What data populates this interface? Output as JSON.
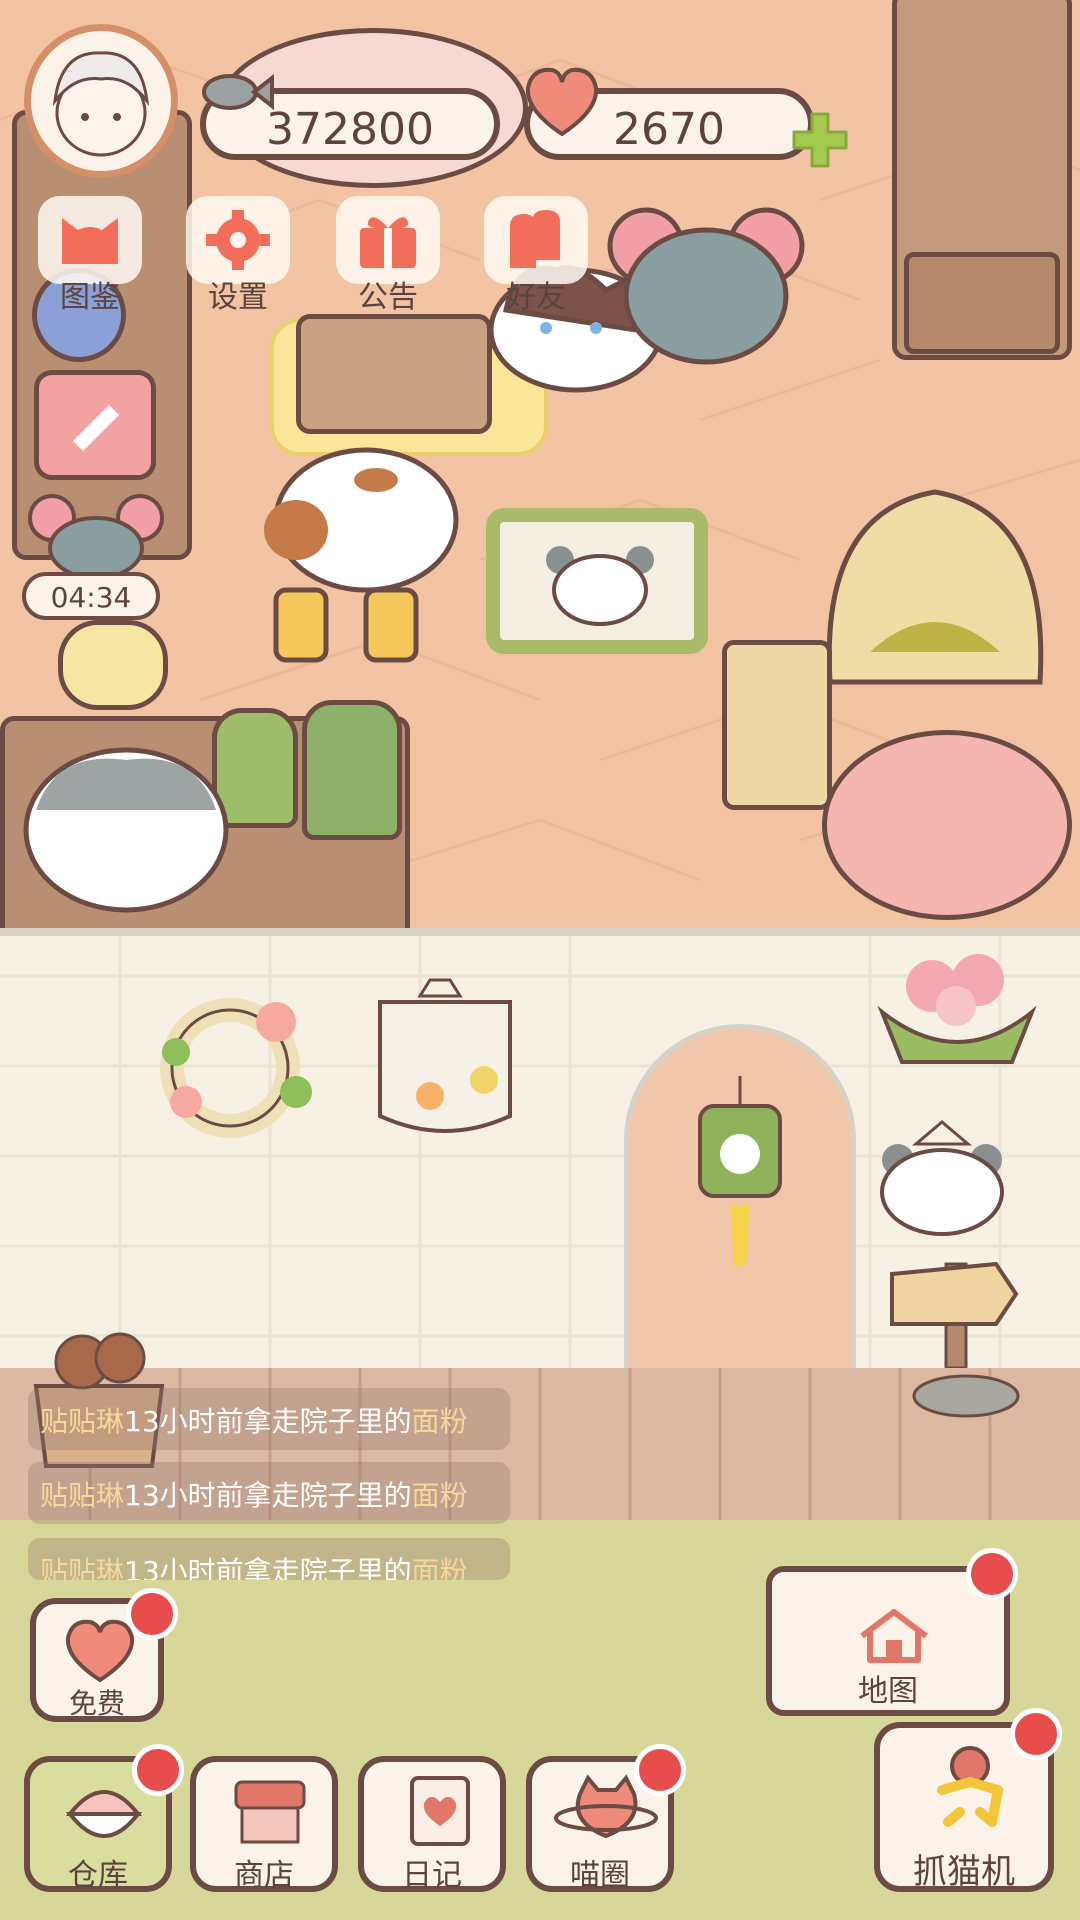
{
  "currencies": {
    "fish_coins": "372800",
    "hearts": "2670"
  },
  "menu": {
    "items": [
      {
        "label": "图鉴",
        "icon": "cat-head-icon"
      },
      {
        "label": "设置",
        "icon": "gear-icon"
      },
      {
        "label": "公告",
        "icon": "gift-icon"
      },
      {
        "label": "好友",
        "icon": "friends-icon"
      }
    ]
  },
  "timer": "04:34",
  "activity_log": [
    {
      "name": "贴贴琳",
      "text": "13小时前拿走院子里的",
      "item": "面粉"
    },
    {
      "name": "贴贴琳",
      "text": "13小时前拿走院子里的",
      "item": "面粉"
    },
    {
      "name": "贴贴琳",
      "text": "13小时前拿走院子里的",
      "item": "面粉"
    }
  ],
  "bottom": {
    "free_label": "免费",
    "map_label": "地图",
    "warehouse_label": "仓库",
    "shop_label": "商店",
    "diary_label": "日记",
    "cat_circle_label": "喵圈",
    "claw_machine_label": "抓猫机"
  },
  "colors": {
    "floor": "#f3c4a4",
    "wall": "#f6f1e4",
    "lawn": "#d8d79a",
    "outline": "#6b4b43",
    "badge": "#e84d4d",
    "accent_pink": "#f08a7a"
  }
}
